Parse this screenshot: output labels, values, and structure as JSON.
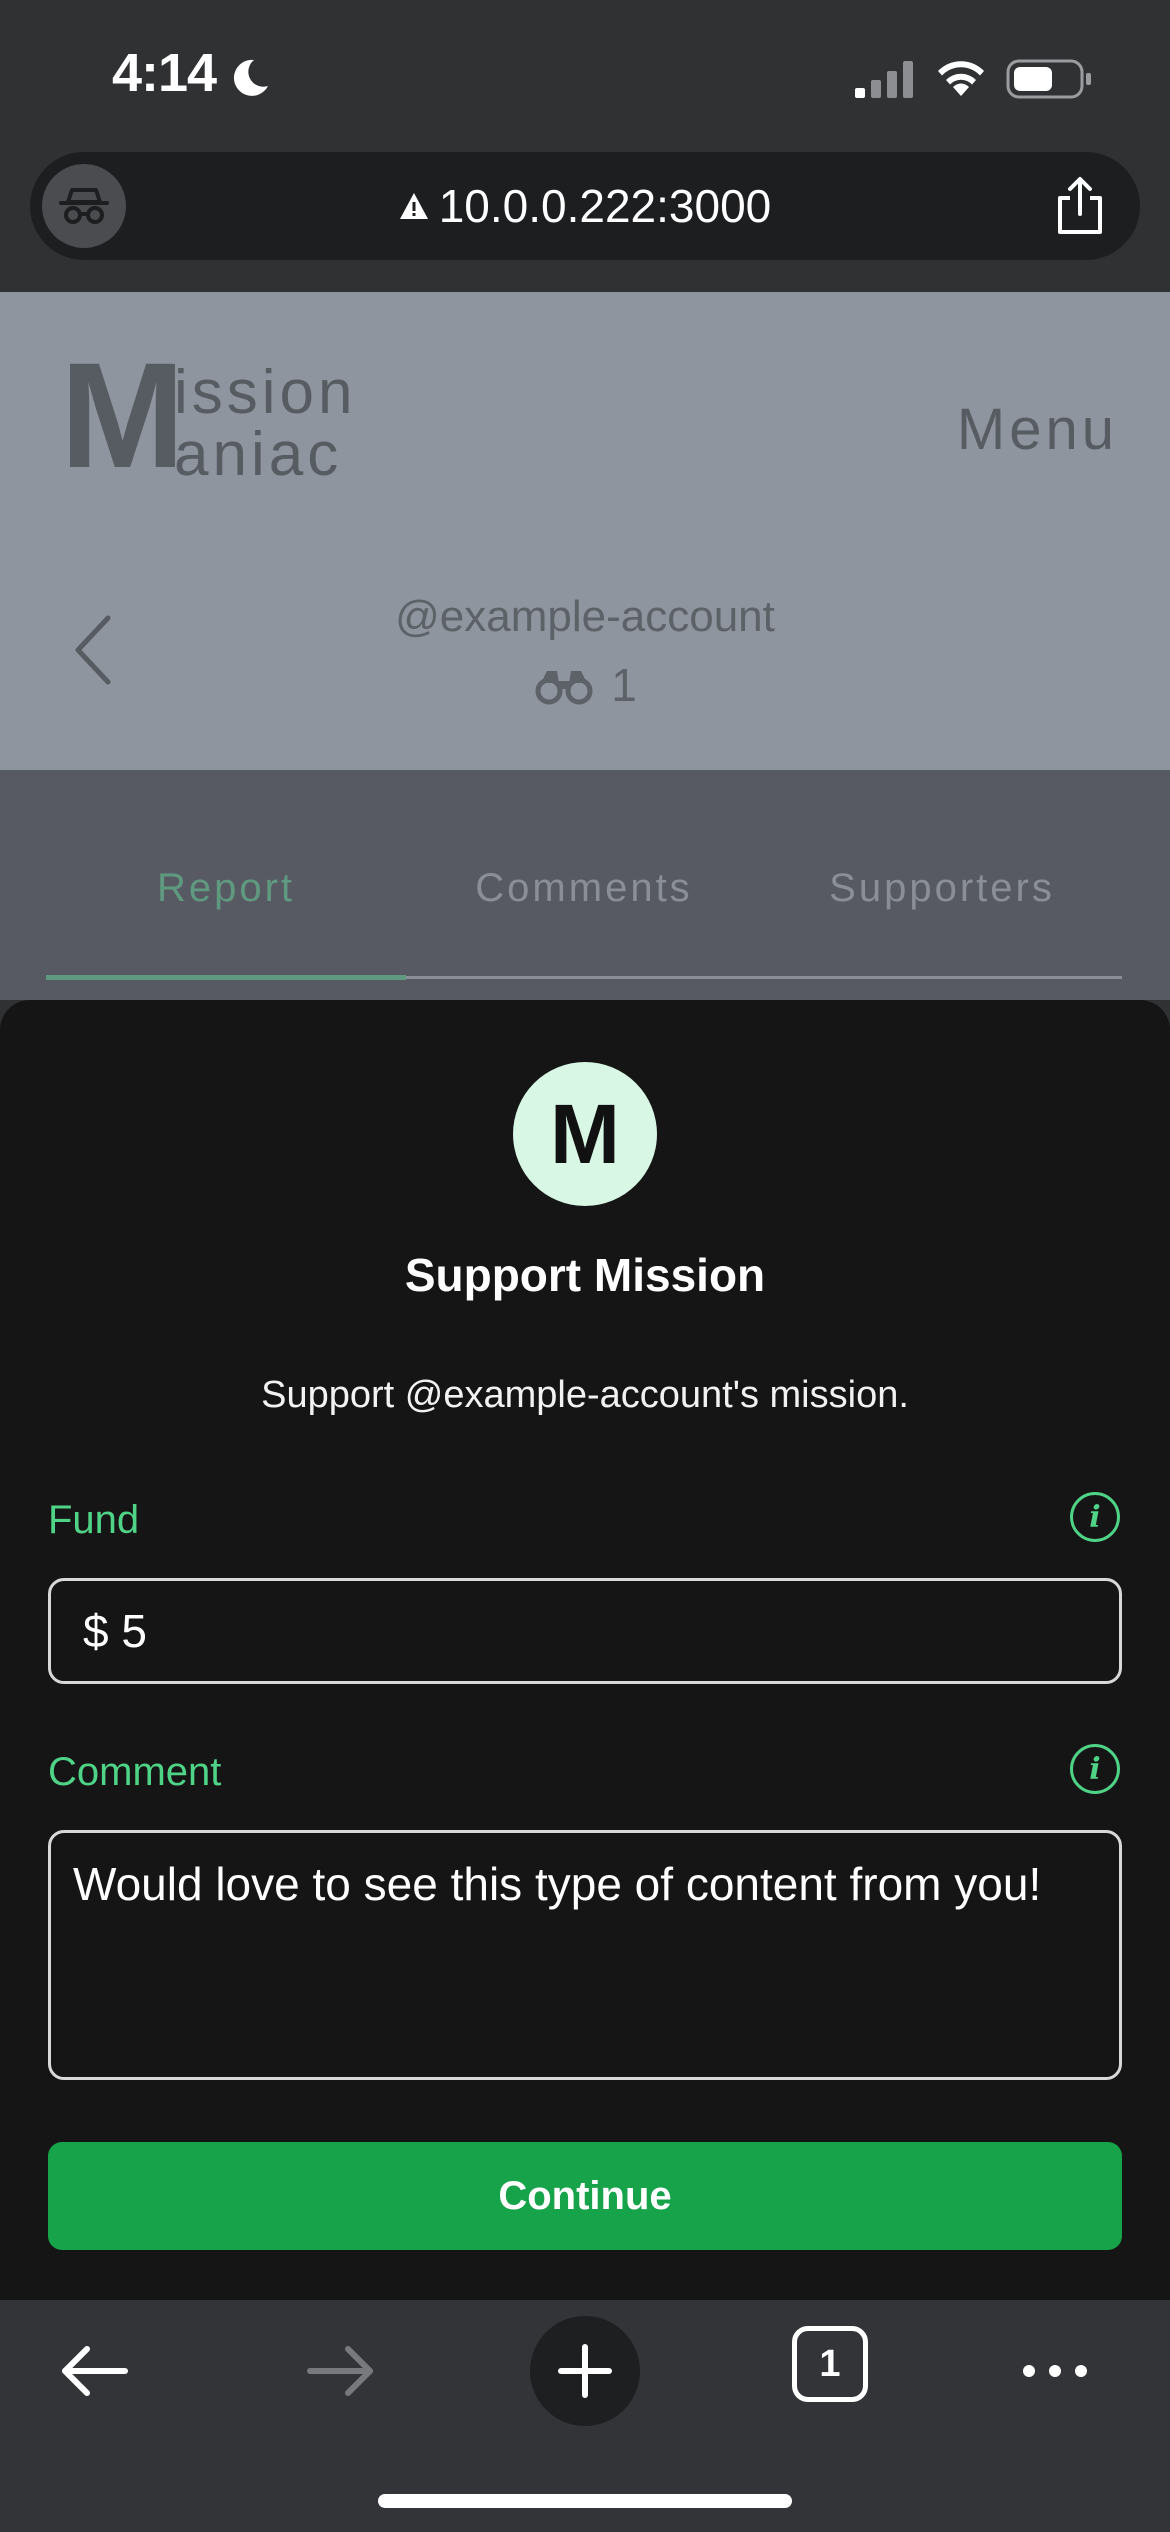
{
  "status_bar": {
    "time": "4:14",
    "icons": [
      "moon-icon",
      "cellular-signal-icon",
      "wifi-icon",
      "battery-icon"
    ]
  },
  "browser": {
    "url": "10.0.0.222:3000",
    "private_icon": "private-browsing-icon",
    "insecure_icon": "warning-icon",
    "share_icon": "share-icon"
  },
  "header": {
    "logo": {
      "initial": "M",
      "line1": "ission",
      "line2": "aniac"
    },
    "menu_label": "Menu",
    "back_icon": "chevron-left-icon",
    "account": "@example-account",
    "followers_count": "1"
  },
  "tabs": [
    {
      "label": "Report",
      "active": true
    },
    {
      "label": "Comments",
      "active": false
    },
    {
      "label": "Supporters",
      "active": false
    }
  ],
  "sheet": {
    "avatar_initial": "M",
    "title": "Support Mission",
    "subtitle": "Support @example-account's mission.",
    "fund": {
      "label": "Fund",
      "value": "$ 5",
      "info_icon": "i"
    },
    "comment": {
      "label": "Comment",
      "value": "Would love to see this type of content from you!",
      "info_icon": "i"
    },
    "continue_label": "Continue"
  },
  "toolbar": {
    "tabs_count": "1",
    "icons": [
      "back-arrow-icon",
      "forward-arrow-icon",
      "plus-icon",
      "tabs-icon",
      "more-icon"
    ]
  },
  "colors": {
    "accent_green": "#4fd386",
    "button_green": "#16a34a",
    "sheet_background": "#151515",
    "avatar_background": "#d8f7e4"
  }
}
